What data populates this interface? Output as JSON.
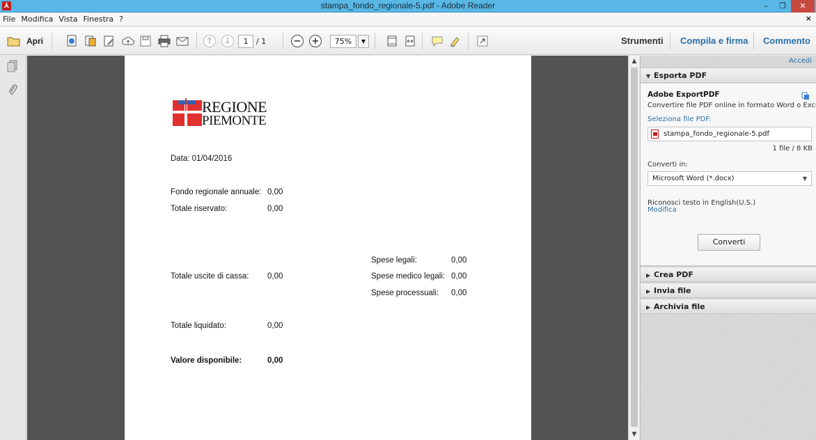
{
  "window": {
    "title": "stampa_fondo_regionale-5.pdf - Adobe Reader",
    "minimize": "–",
    "restore": "❐",
    "close": "✕"
  },
  "menu": {
    "items": [
      "File",
      "Modifica",
      "Vista",
      "Finestra",
      "?"
    ],
    "close": "×"
  },
  "toolbar": {
    "open_label": "Apri",
    "page_current": "1",
    "page_total": "/ 1",
    "zoom": "75%",
    "tabs": [
      "Strumenti",
      "Compila e firma",
      "Commento"
    ]
  },
  "document": {
    "logo": {
      "line1": "REGIONE",
      "line2": "PIEMONTE",
      "colors": {
        "red": "#e03030"
      }
    },
    "date": "Data: 01/04/2016",
    "fondo_label": "Fondo regionale annuale:",
    "fondo_value": "0,00",
    "riservato_label": "Totale riservato:",
    "riservato_value": "0,00",
    "spese_legali_label": "Spese legali:",
    "spese_legali_value": "0,00",
    "uscite_label": "Totale uscite di cassa:",
    "uscite_value": "0,00",
    "spese_medico_label": "Spese medico legali:",
    "spese_medico_value": "0,00",
    "spese_proc_label": "Spese processuali:",
    "spese_proc_value": "0,00",
    "liquidato_label": "Totale liquidato:",
    "liquidato_value": "0,00",
    "disponibile_label": "Valore disponibile:",
    "disponibile_value": "0,00"
  },
  "rightpane": {
    "accedi": "Accedi",
    "export_header": "Esporta PDF",
    "export_title": "Adobe ExportPDF",
    "export_desc": "Convertire file PDF online in formato Word o Excel.",
    "select_label": "Seleziona file PDF:",
    "file_name": "stampa_fondo_regionale-5.pdf",
    "file_count": "1 file / 8 KB",
    "convert_to_label": "Converti in:",
    "convert_to_value": "Microsoft Word (*.docx)",
    "ocr_text": "Riconosci testo in English(U.S.)",
    "ocr_modify": "Modifica",
    "convert_button": "Converti",
    "sections": [
      "Crea PDF",
      "Invia file",
      "Archivia file"
    ]
  },
  "colors": {
    "titlebar": "#58b7e4",
    "link": "#2a70a8",
    "doc_background": "#535353",
    "pdf_red": "#c71a1a"
  }
}
